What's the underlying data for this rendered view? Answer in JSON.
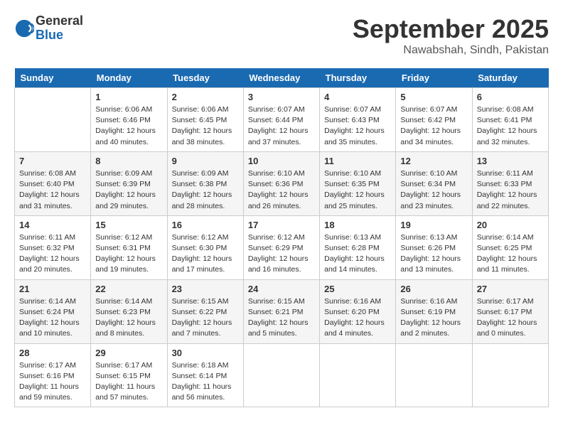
{
  "logo": {
    "general": "General",
    "blue": "Blue"
  },
  "title": "September 2025",
  "subtitle": "Nawabshah, Sindh, Pakistan",
  "headers": [
    "Sunday",
    "Monday",
    "Tuesday",
    "Wednesday",
    "Thursday",
    "Friday",
    "Saturday"
  ],
  "weeks": [
    [
      {
        "date": "",
        "text": ""
      },
      {
        "date": "1",
        "text": "Sunrise: 6:06 AM\nSunset: 6:46 PM\nDaylight: 12 hours\nand 40 minutes."
      },
      {
        "date": "2",
        "text": "Sunrise: 6:06 AM\nSunset: 6:45 PM\nDaylight: 12 hours\nand 38 minutes."
      },
      {
        "date": "3",
        "text": "Sunrise: 6:07 AM\nSunset: 6:44 PM\nDaylight: 12 hours\nand 37 minutes."
      },
      {
        "date": "4",
        "text": "Sunrise: 6:07 AM\nSunset: 6:43 PM\nDaylight: 12 hours\nand 35 minutes."
      },
      {
        "date": "5",
        "text": "Sunrise: 6:07 AM\nSunset: 6:42 PM\nDaylight: 12 hours\nand 34 minutes."
      },
      {
        "date": "6",
        "text": "Sunrise: 6:08 AM\nSunset: 6:41 PM\nDaylight: 12 hours\nand 32 minutes."
      }
    ],
    [
      {
        "date": "7",
        "text": "Sunrise: 6:08 AM\nSunset: 6:40 PM\nDaylight: 12 hours\nand 31 minutes."
      },
      {
        "date": "8",
        "text": "Sunrise: 6:09 AM\nSunset: 6:39 PM\nDaylight: 12 hours\nand 29 minutes."
      },
      {
        "date": "9",
        "text": "Sunrise: 6:09 AM\nSunset: 6:38 PM\nDaylight: 12 hours\nand 28 minutes."
      },
      {
        "date": "10",
        "text": "Sunrise: 6:10 AM\nSunset: 6:36 PM\nDaylight: 12 hours\nand 26 minutes."
      },
      {
        "date": "11",
        "text": "Sunrise: 6:10 AM\nSunset: 6:35 PM\nDaylight: 12 hours\nand 25 minutes."
      },
      {
        "date": "12",
        "text": "Sunrise: 6:10 AM\nSunset: 6:34 PM\nDaylight: 12 hours\nand 23 minutes."
      },
      {
        "date": "13",
        "text": "Sunrise: 6:11 AM\nSunset: 6:33 PM\nDaylight: 12 hours\nand 22 minutes."
      }
    ],
    [
      {
        "date": "14",
        "text": "Sunrise: 6:11 AM\nSunset: 6:32 PM\nDaylight: 12 hours\nand 20 minutes."
      },
      {
        "date": "15",
        "text": "Sunrise: 6:12 AM\nSunset: 6:31 PM\nDaylight: 12 hours\nand 19 minutes."
      },
      {
        "date": "16",
        "text": "Sunrise: 6:12 AM\nSunset: 6:30 PM\nDaylight: 12 hours\nand 17 minutes."
      },
      {
        "date": "17",
        "text": "Sunrise: 6:12 AM\nSunset: 6:29 PM\nDaylight: 12 hours\nand 16 minutes."
      },
      {
        "date": "18",
        "text": "Sunrise: 6:13 AM\nSunset: 6:28 PM\nDaylight: 12 hours\nand 14 minutes."
      },
      {
        "date": "19",
        "text": "Sunrise: 6:13 AM\nSunset: 6:26 PM\nDaylight: 12 hours\nand 13 minutes."
      },
      {
        "date": "20",
        "text": "Sunrise: 6:14 AM\nSunset: 6:25 PM\nDaylight: 12 hours\nand 11 minutes."
      }
    ],
    [
      {
        "date": "21",
        "text": "Sunrise: 6:14 AM\nSunset: 6:24 PM\nDaylight: 12 hours\nand 10 minutes."
      },
      {
        "date": "22",
        "text": "Sunrise: 6:14 AM\nSunset: 6:23 PM\nDaylight: 12 hours\nand 8 minutes."
      },
      {
        "date": "23",
        "text": "Sunrise: 6:15 AM\nSunset: 6:22 PM\nDaylight: 12 hours\nand 7 minutes."
      },
      {
        "date": "24",
        "text": "Sunrise: 6:15 AM\nSunset: 6:21 PM\nDaylight: 12 hours\nand 5 minutes."
      },
      {
        "date": "25",
        "text": "Sunrise: 6:16 AM\nSunset: 6:20 PM\nDaylight: 12 hours\nand 4 minutes."
      },
      {
        "date": "26",
        "text": "Sunrise: 6:16 AM\nSunset: 6:19 PM\nDaylight: 12 hours\nand 2 minutes."
      },
      {
        "date": "27",
        "text": "Sunrise: 6:17 AM\nSunset: 6:17 PM\nDaylight: 12 hours\nand 0 minutes."
      }
    ],
    [
      {
        "date": "28",
        "text": "Sunrise: 6:17 AM\nSunset: 6:16 PM\nDaylight: 11 hours\nand 59 minutes."
      },
      {
        "date": "29",
        "text": "Sunrise: 6:17 AM\nSunset: 6:15 PM\nDaylight: 11 hours\nand 57 minutes."
      },
      {
        "date": "30",
        "text": "Sunrise: 6:18 AM\nSunset: 6:14 PM\nDaylight: 11 hours\nand 56 minutes."
      },
      {
        "date": "",
        "text": ""
      },
      {
        "date": "",
        "text": ""
      },
      {
        "date": "",
        "text": ""
      },
      {
        "date": "",
        "text": ""
      }
    ]
  ]
}
